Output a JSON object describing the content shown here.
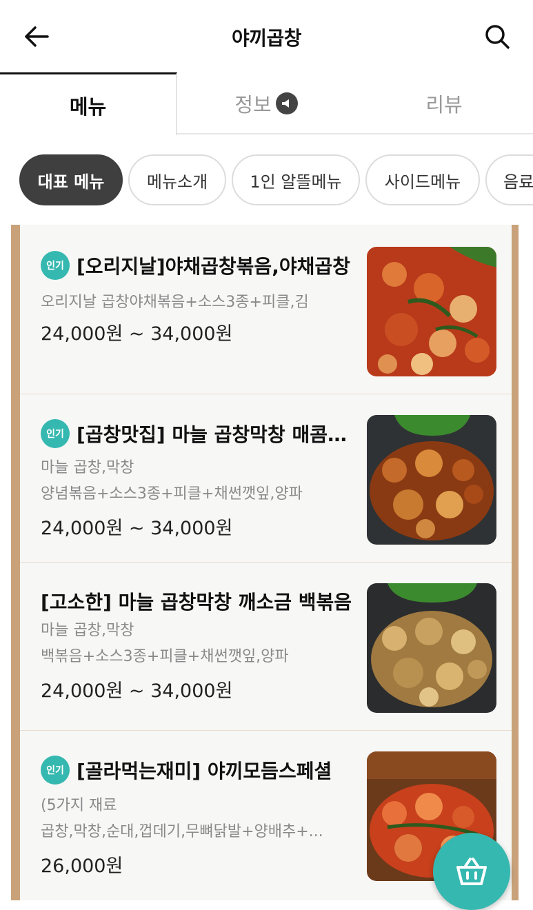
{
  "header": {
    "title": "야끼곱창"
  },
  "tabs": [
    {
      "label": "메뉴",
      "active": true
    },
    {
      "label": "정보",
      "active": false
    },
    {
      "label": "리뷰",
      "active": false
    }
  ],
  "chips": [
    "대표 메뉴",
    "메뉴소개",
    "1인 알뜰메뉴",
    "사이드메뉴",
    "음료"
  ],
  "popular_badge": "인기",
  "colors": {
    "accent": "#35b8b0",
    "frame": "#c9a27a"
  },
  "menu": [
    {
      "popular": true,
      "name": "[오리지날]야채곱창볶음,야채곱창",
      "desc1": "오리지날 곱창야채볶음+소스3종+피클,김",
      "desc2": "",
      "price": "24,000원 ~ 34,000원"
    },
    {
      "popular": true,
      "name": "[곱창맛집] 마늘 곱창막창 매콤볶음",
      "desc1": "마늘 곱창,막창",
      "desc2": "양념볶음+소스3종+피클+채썬깻잎,양파",
      "price": "24,000원 ~ 34,000원"
    },
    {
      "popular": false,
      "name": "[고소한] 마늘 곱창막창 깨소금 백볶음",
      "desc1": "마늘 곱창,막창",
      "desc2": "백볶음+소스3종+피클+채썬깻잎,양파",
      "price": "24,000원 ~ 34,000원"
    },
    {
      "popular": true,
      "name": "[골라먹는재미] 야끼모듬스페셜",
      "desc1": "(5가지 재료",
      "desc2": "곱창,막창,순대,껍데기,무뼈닭발+양배추+...",
      "price": "26,000원"
    }
  ]
}
